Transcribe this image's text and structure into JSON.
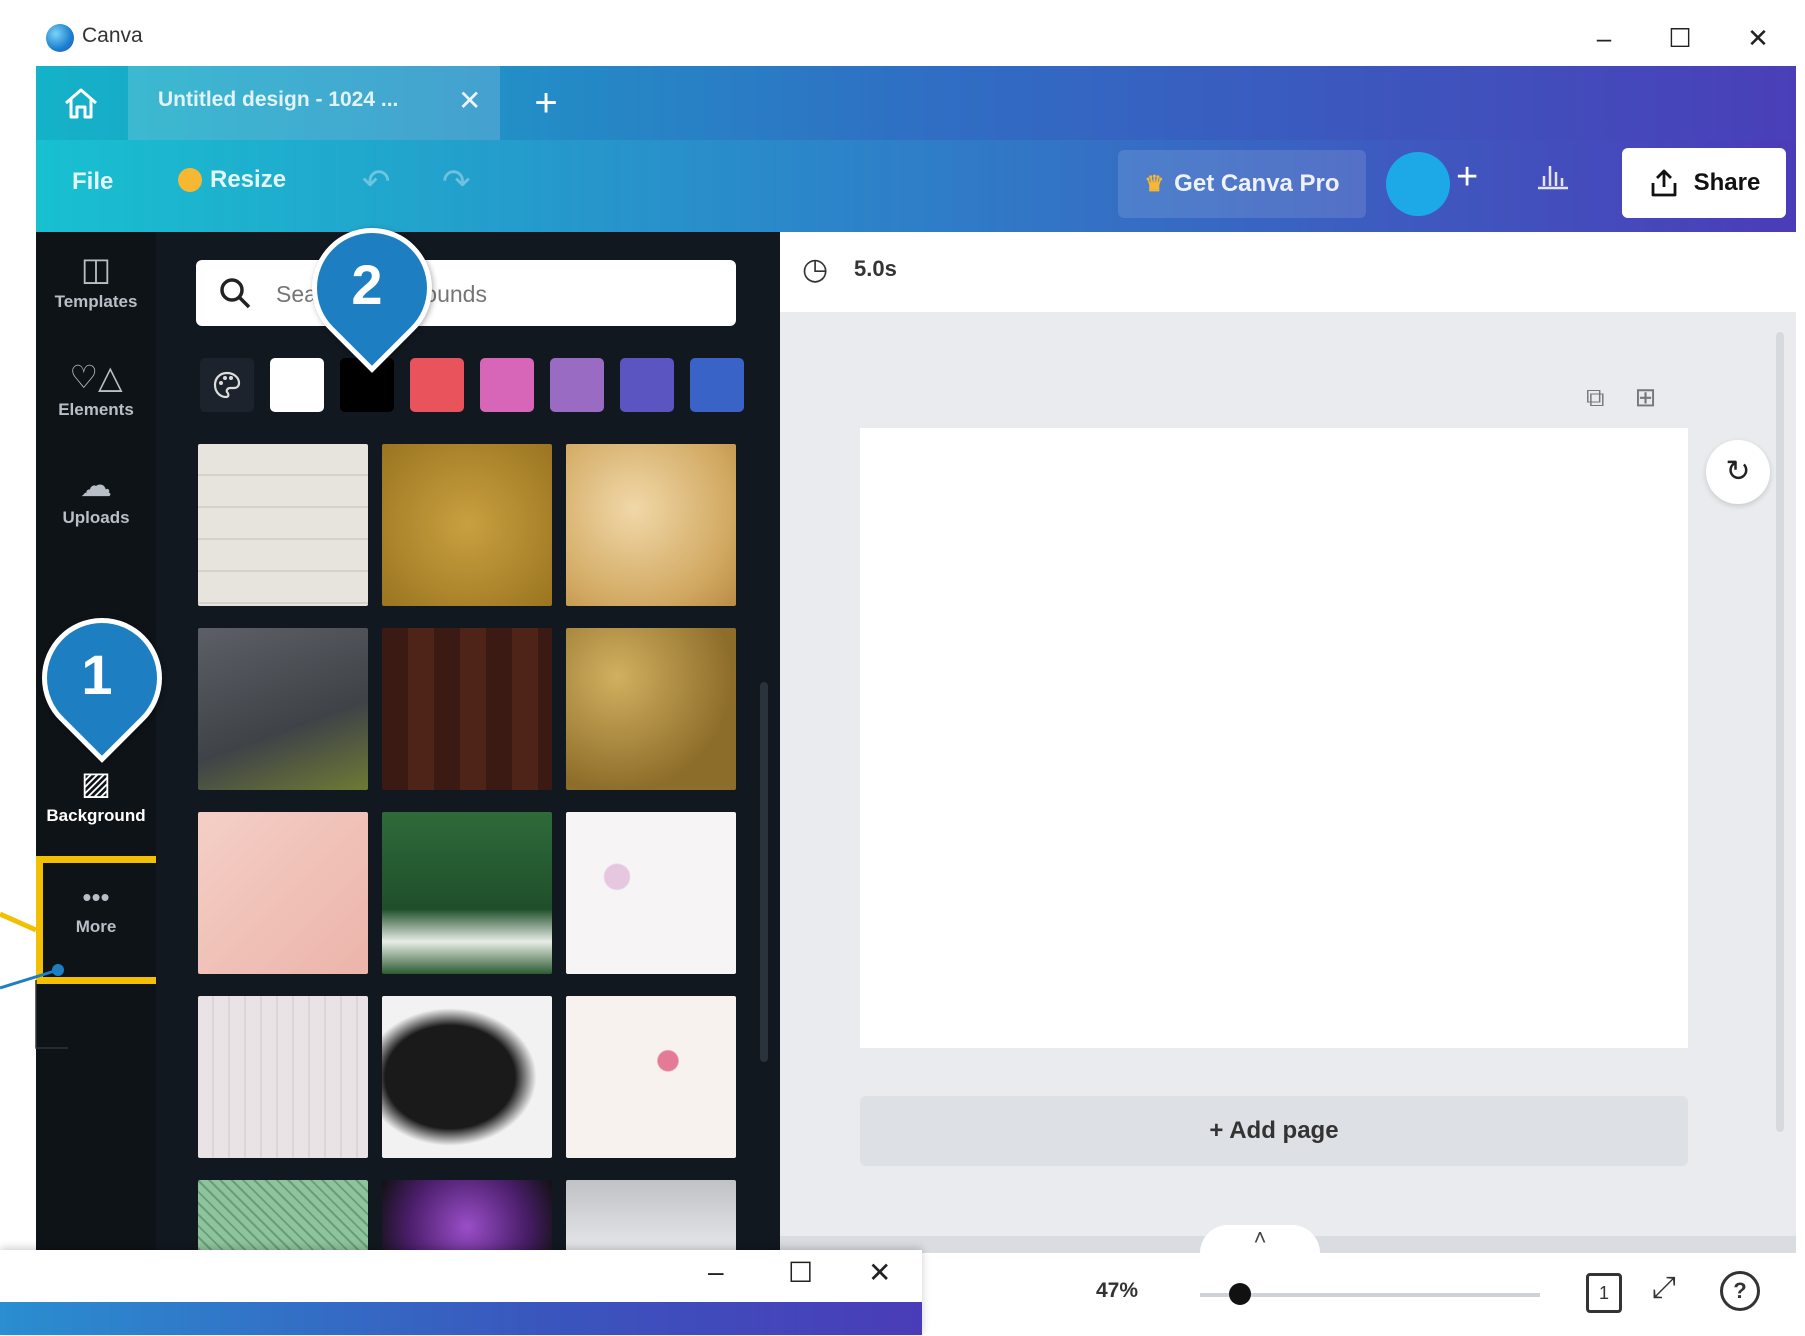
{
  "window": {
    "app_name": "Canva",
    "minimize": "–",
    "maximize": "☐",
    "close": "✕"
  },
  "tabs": {
    "home_icon": "home-icon",
    "active_tab_label": "Untitled design - 1024 ...",
    "close_tab": "✕",
    "new_tab": "+"
  },
  "toolbar": {
    "file_label": "File",
    "resize_label": "Resize",
    "undo": "↶",
    "redo": "↷",
    "pro_label": "Get Canva Pro",
    "add_member": "+",
    "insights_icon": "bar-chart-icon",
    "share_label": "Share"
  },
  "sidebar": {
    "items": [
      {
        "label": "Templates",
        "icon": "templates-icon"
      },
      {
        "label": "Elements",
        "icon": "elements-icon"
      },
      {
        "label": "Uploads",
        "icon": "uploads-icon"
      },
      {
        "label": "Background",
        "icon": "background-icon"
      },
      {
        "label": "More",
        "icon": "more-icon"
      }
    ]
  },
  "panel": {
    "search_placeholder": "Search backgrounds",
    "swatches": [
      {
        "name": "white",
        "color": "#ffffff"
      },
      {
        "name": "black",
        "color": "#000000"
      },
      {
        "name": "red",
        "color": "#e9545c"
      },
      {
        "name": "pink",
        "color": "#d765b8"
      },
      {
        "name": "light-purple",
        "color": "#9a6bc3"
      },
      {
        "name": "indigo",
        "color": "#5b55c2"
      },
      {
        "name": "blue",
        "color": "#3a63c7"
      }
    ],
    "swatch_next": "›",
    "thumbnails": [
      "white-wood",
      "gold-glitter",
      "gold-marble",
      "tennis-court",
      "dark-wood",
      "gold-coins",
      "pink-texture",
      "soccer-field",
      "floral-petals",
      "white-wall",
      "black-brushstroke",
      "pink-floral",
      "green-net",
      "purple-flowers",
      "grey-gradient"
    ]
  },
  "badges": {
    "one": "1",
    "two": "2"
  },
  "editor": {
    "timer_label": "5.0s",
    "add_page_label": "+ Add page"
  },
  "statusbar": {
    "zoom_label": "47%",
    "page_count": "1",
    "collapse": "˄",
    "help": "?",
    "zoom_percent": 47
  },
  "second_window": {
    "minimize": "–",
    "maximize": "☐",
    "close": "✕"
  },
  "colors": {
    "highlight": "#f2c000",
    "badge": "#1d7fc2",
    "avatar": "#1da9e8"
  }
}
